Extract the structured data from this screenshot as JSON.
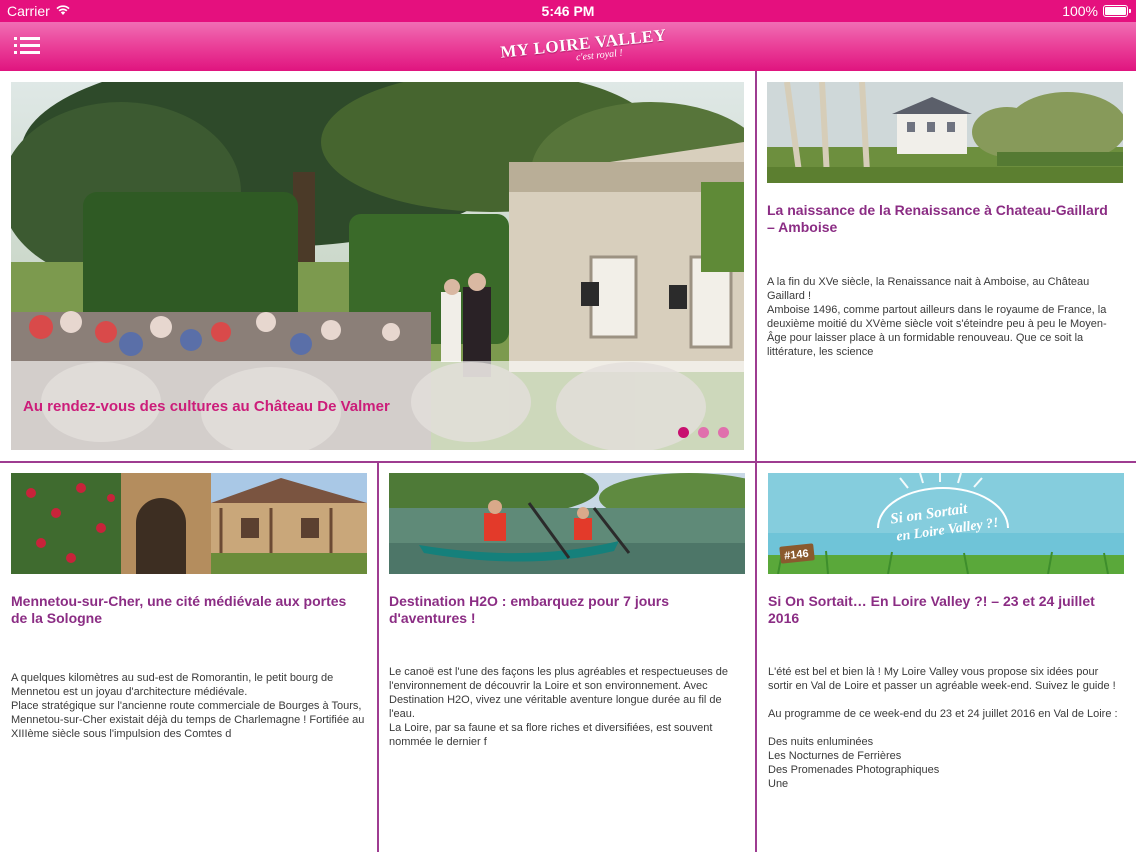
{
  "status_bar": {
    "carrier": "Carrier",
    "time": "5:46 PM",
    "battery": "100%"
  },
  "navbar": {
    "logo_main": "MY LOIRE VALLEY",
    "logo_sub": "c'est royal !"
  },
  "featured": {
    "caption": "Au rendez-vous des cultures au Château De Valmer",
    "slides_count": 3,
    "active_slide": 1
  },
  "articles": [
    {
      "title": "La naissance de la Renaissance à Chateau-Gaillard – Amboise",
      "body": [
        "A la fin du XVe siècle, la Renaissance nait à Amboise, au Château Gaillard !",
        "Amboise 1496, comme partout ailleurs dans le royaume de France, la deuxième moitié du XVème siècle voit s'éteindre peu à peu le Moyen-Âge pour laisser place à un formidable renouveau. Que ce soit la littérature, les science"
      ]
    },
    {
      "title": "Mennetou-sur-Cher, une cité médiévale aux portes de la Sologne",
      "body": [
        "A quelques kilomètres au sud-est de Romorantin, le petit bourg de Mennetou est un joyau d'architecture médiévale.",
        "Place stratégique sur l'ancienne route commerciale de Bourges à Tours, Mennetou-sur-Cher existait déjà du temps de Charlemagne ! Fortifiée au XIIIème siècle sous l'impulsion des Comtes d"
      ]
    },
    {
      "title": "Destination H2O : embarquez pour 7 jours d'aventures !",
      "body": [
        "Le canoë est l'une des façons les plus agréables et respectueuses de l'environnement de découvrir la Loire et son environnement. Avec Destination H2O, vivez une véritable aventure longue durée au fil de l'eau.",
        "La Loire, par sa faune et sa flore riches et diversifiées, est souvent nommée le dernier f"
      ]
    },
    {
      "title": "Si On Sortait… En Loire Valley ?! – 23 et 24 juillet 2016",
      "body": [
        "L'été est bel et bien là ! My Loire Valley vous propose six idées pour sortir en Val de Loire et passer un agréable week-end. Suivez le guide !",
        "Au programme de ce week-end du 23 et 24 juillet 2016 en Val de Loire :",
        "Des nuits enluminées",
        "Les Nocturnes de Ferrières",
        "Des Promenades Photographiques",
        "Une"
      ],
      "thumb_text_1": "Si on Sortait",
      "thumb_text_2": "en Loire Valley ?!",
      "thumb_tag": "#146"
    }
  ]
}
